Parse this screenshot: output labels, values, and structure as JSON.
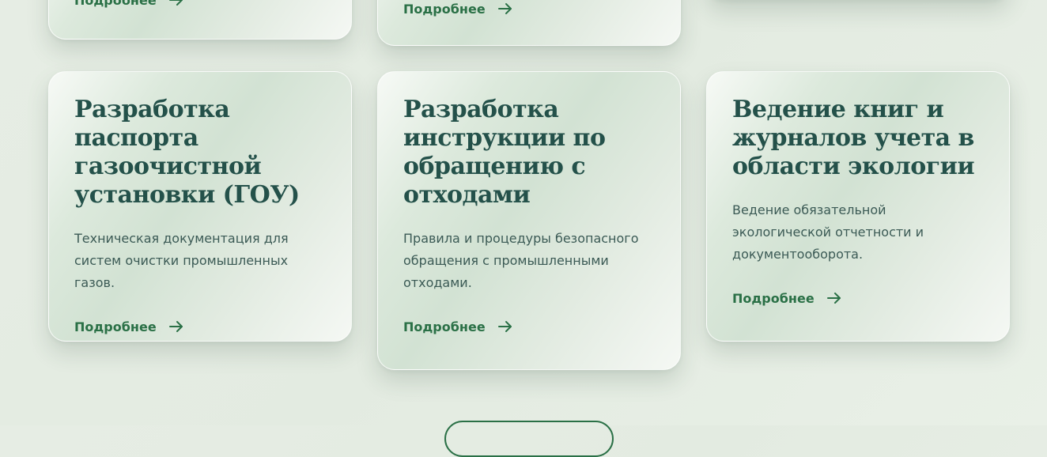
{
  "top_row": {
    "cards": [
      {
        "link_label": "Подробнее"
      },
      {
        "link_label": "Подробнее"
      }
    ]
  },
  "services": [
    {
      "title": "Разработка паспорта газоочистной установки (ГОУ)",
      "description": "Техническая документация для систем очистки промышленных газов.",
      "link_label": "Подробнее"
    },
    {
      "title": "Разработка инструкции по обращению с отходами",
      "description": "Правила и процедуры безопасного обращения с промышленными отходами.",
      "link_label": "Подробнее"
    },
    {
      "title": "Ведение книг и журналов учета в области экологии",
      "description": "Ведение обязательной экологической отчетности и документооборота.",
      "link_label": "Подробнее"
    }
  ],
  "colors": {
    "accent": "#2a7046",
    "heading": "#24514a",
    "text": "#3b5a55"
  }
}
